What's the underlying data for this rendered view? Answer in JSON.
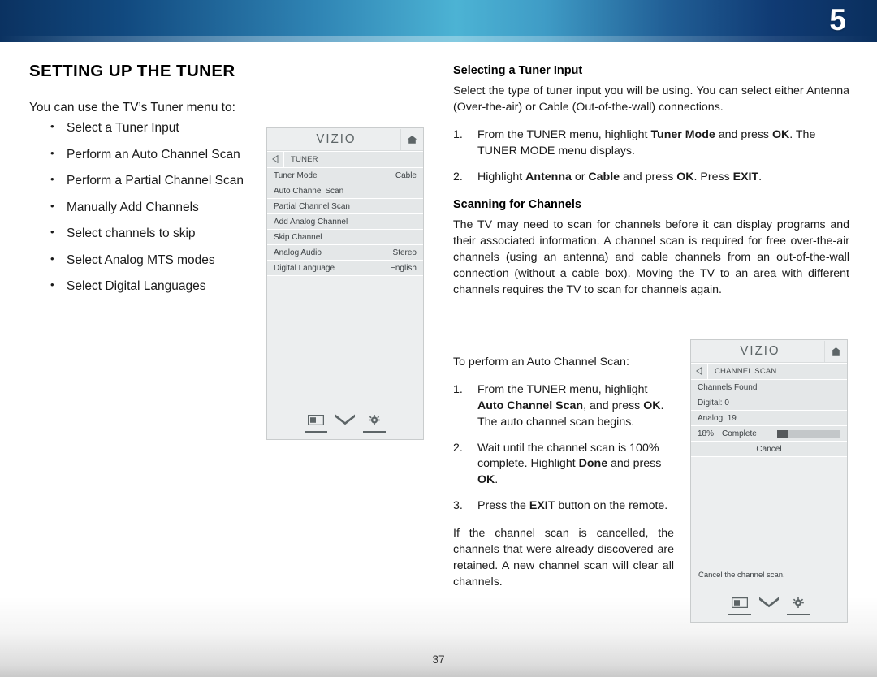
{
  "header": {
    "chapter_number": "5",
    "gradient_dark": "#0b3261",
    "gradient_light": "#4cb3d4"
  },
  "left_column": {
    "title": "SETTING UP THE TUNER",
    "lead": "You can use the TV’s Tuner menu to:",
    "bullets": [
      "Select a Tuner Input",
      "Perform an Auto Channel Scan",
      "Perform a Partial Channel Scan",
      "Manually Add Channels",
      "Select channels to skip",
      "Select Analog MTS modes",
      "Select Digital Languages"
    ]
  },
  "tuner_panel": {
    "logo": "VIZIO",
    "home_icon": "home-icon",
    "back_icon": "back-triangle-icon",
    "breadcrumb": "TUNER",
    "rows": [
      {
        "label": "Tuner Mode",
        "value": "Cable"
      },
      {
        "label": "Auto Channel Scan",
        "value": ""
      },
      {
        "label": "Partial Channel Scan",
        "value": ""
      },
      {
        "label": "Add Analog Channel",
        "value": ""
      },
      {
        "label": "Skip Channel",
        "value": ""
      },
      {
        "label": "Analog Audio",
        "value": "Stereo"
      },
      {
        "label": "Digital Language",
        "value": "English"
      }
    ],
    "footer_icons": [
      "picture-in-picture-icon",
      "chevron-double-down-icon",
      "gear-icon"
    ]
  },
  "right_column": {
    "selecting_heading": "Selecting a Tuner Input",
    "selecting_body": "Select the type of tuner input you will be using. You can select either Antenna (Over-the-air) or Cable (Out-of-the-wall) connections.",
    "selecting_steps": [
      {
        "parts": [
          {
            "t": "From the TUNER menu, highlight ",
            "b": false
          },
          {
            "t": "Tuner Mode",
            "b": true
          },
          {
            "t": " and press ",
            "b": false
          },
          {
            "t": "OK",
            "b": true
          },
          {
            "t": ". The TUNER MODE menu displays.",
            "b": false
          }
        ]
      },
      {
        "parts": [
          {
            "t": "Highlight ",
            "b": false
          },
          {
            "t": "Antenna",
            "b": true
          },
          {
            "t": " or ",
            "b": false
          },
          {
            "t": "Cable",
            "b": true
          },
          {
            "t": " and press ",
            "b": false
          },
          {
            "t": "OK",
            "b": true
          },
          {
            "t": ". Press ",
            "b": false
          },
          {
            "t": "EXIT",
            "b": true
          },
          {
            "t": ".",
            "b": false
          }
        ]
      }
    ],
    "scanning_heading": "Scanning for Channels",
    "scanning_body": "The TV may need to scan for channels before it can display programs and their associated information. A channel scan is required for free over-the-air channels (using an antenna) and cable channels from an out-of-the-wall connection (without a cable box). Moving the TV to an area with different channels requires the TV to scan for channels again.",
    "auto_scan_lead": "To perform an Auto Channel Scan:",
    "auto_scan_steps": [
      {
        "parts": [
          {
            "t": "From the TUNER menu, highlight ",
            "b": false
          },
          {
            "t": "Auto Channel Scan",
            "b": true
          },
          {
            "t": ", and press ",
            "b": false
          },
          {
            "t": "OK",
            "b": true
          },
          {
            "t": ". The auto channel scan begins.",
            "b": false
          }
        ]
      },
      {
        "parts": [
          {
            "t": "Wait until the channel scan is 100% complete. Highlight ",
            "b": false
          },
          {
            "t": "Done",
            "b": true
          },
          {
            "t": " and press ",
            "b": false
          },
          {
            "t": "OK",
            "b": true
          },
          {
            "t": ".",
            "b": false
          }
        ]
      },
      {
        "parts": [
          {
            "t": "Press the ",
            "b": false
          },
          {
            "t": "EXIT",
            "b": true
          },
          {
            "t": " button on the remote.",
            "b": false
          }
        ]
      }
    ],
    "cancel_note": "If the channel scan is cancelled, the channels that were already discovered are retained. A new channel scan will clear all channels."
  },
  "scan_panel": {
    "logo": "VIZIO",
    "home_icon": "home-icon",
    "back_icon": "back-triangle-icon",
    "breadcrumb": "CHANNEL SCAN",
    "rows": [
      {
        "label": "Channels Found",
        "value": ""
      },
      {
        "label": "Digital:  0",
        "value": ""
      },
      {
        "label": "Analog: 19",
        "value": ""
      }
    ],
    "progress": {
      "percent_label": "18%",
      "complete_label": "Complete",
      "percent_value": 18
    },
    "cancel_label": "Cancel",
    "hint": "Cancel the channel scan.",
    "footer_icons": [
      "picture-in-picture-icon",
      "chevron-double-down-icon",
      "gear-icon"
    ]
  },
  "footer": {
    "page_number": "37"
  }
}
